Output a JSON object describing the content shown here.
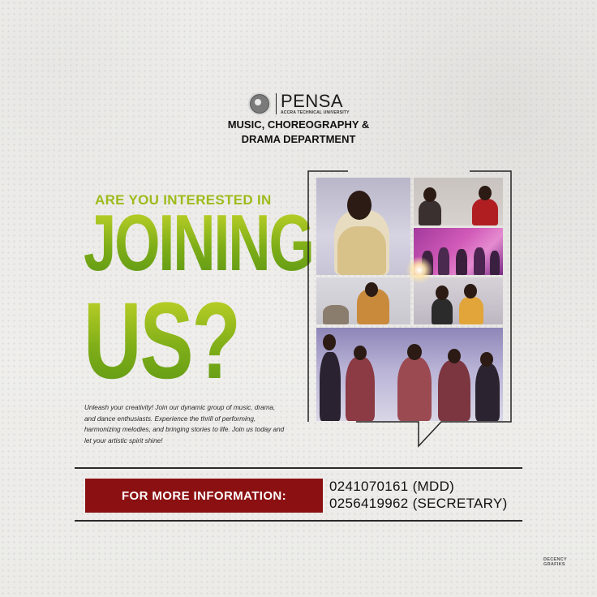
{
  "header": {
    "brand": "PENSA",
    "brand_sub": "ACCRA TECHNICAL UNIVERSITY",
    "department_line1": "MUSIC, CHOREOGRAPHY &",
    "department_line2": "DRAMA DEPARTMENT"
  },
  "headline": {
    "kicker": "ARE YOU INTERESTED IN",
    "line1": "JOINING",
    "line2": "US?"
  },
  "blurb": "Unleash your creativity! Join our dynamic group of music, drama, and dance enthusiasts. Experience the thrill of performing, harmonizing melodies, and bringing stories to life. Join us today and let your artistic spirit shine!",
  "contact": {
    "button_label": "FOR MORE INFORMATION:",
    "phone1": "0241070161 (MDD)",
    "phone2": "0256419962 (SECRETARY)"
  },
  "credit_line1": "DECENCY",
  "credit_line2": "GRAFIKS",
  "colors": {
    "accent_green": "#8bb61a",
    "accent_red": "#8b1012",
    "text_dark": "#111111"
  }
}
